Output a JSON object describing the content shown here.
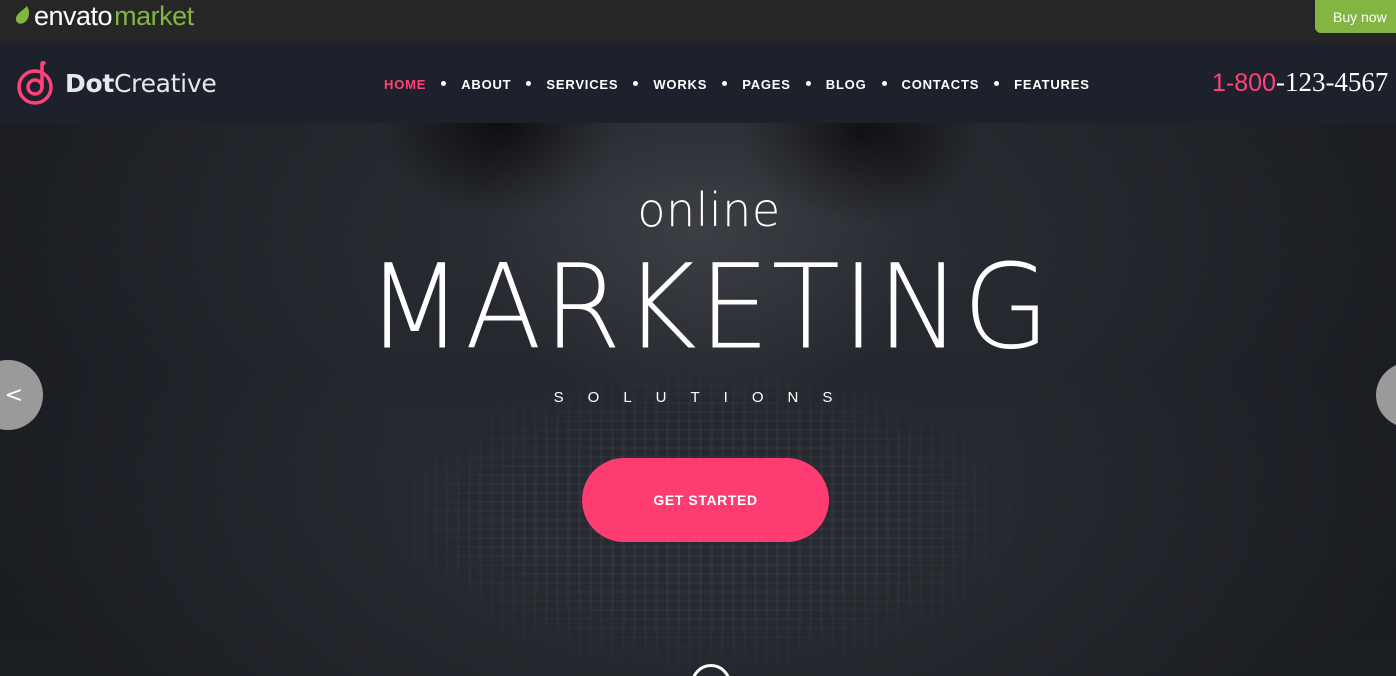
{
  "envato": {
    "logo_word": "envato",
    "logo_market": "market",
    "buy_now_label": "Buy now",
    "accent_color": "#82b541"
  },
  "header": {
    "brand": {
      "bold": "Dot",
      "light": "Creative",
      "mark_color": "#ff4277"
    },
    "nav": [
      {
        "label": "HOME",
        "active": true
      },
      {
        "label": "ABOUT",
        "active": false
      },
      {
        "label": "SERVICES",
        "active": false
      },
      {
        "label": "WORKS",
        "active": false
      },
      {
        "label": "PAGES",
        "active": false
      },
      {
        "label": "BLOG",
        "active": false
      },
      {
        "label": "CONTACTS",
        "active": false
      },
      {
        "label": "FEATURES",
        "active": false
      }
    ],
    "phone": {
      "prefix": "1-800",
      "number": "-123-4567"
    }
  },
  "hero": {
    "kicker": "online",
    "title": "MARKETING",
    "subtitle": "SOLUTIONS",
    "cta_label": "GET STARTED",
    "prev_arrow": "<",
    "cta_color": "#ff3c72"
  },
  "icons": {
    "envato_leaf": "leaf-icon",
    "brand_mark": "dotcreative-logo-icon",
    "prev": "chevron-left-icon",
    "next": "chevron-right-icon",
    "scroll": "scroll-down-icon"
  }
}
